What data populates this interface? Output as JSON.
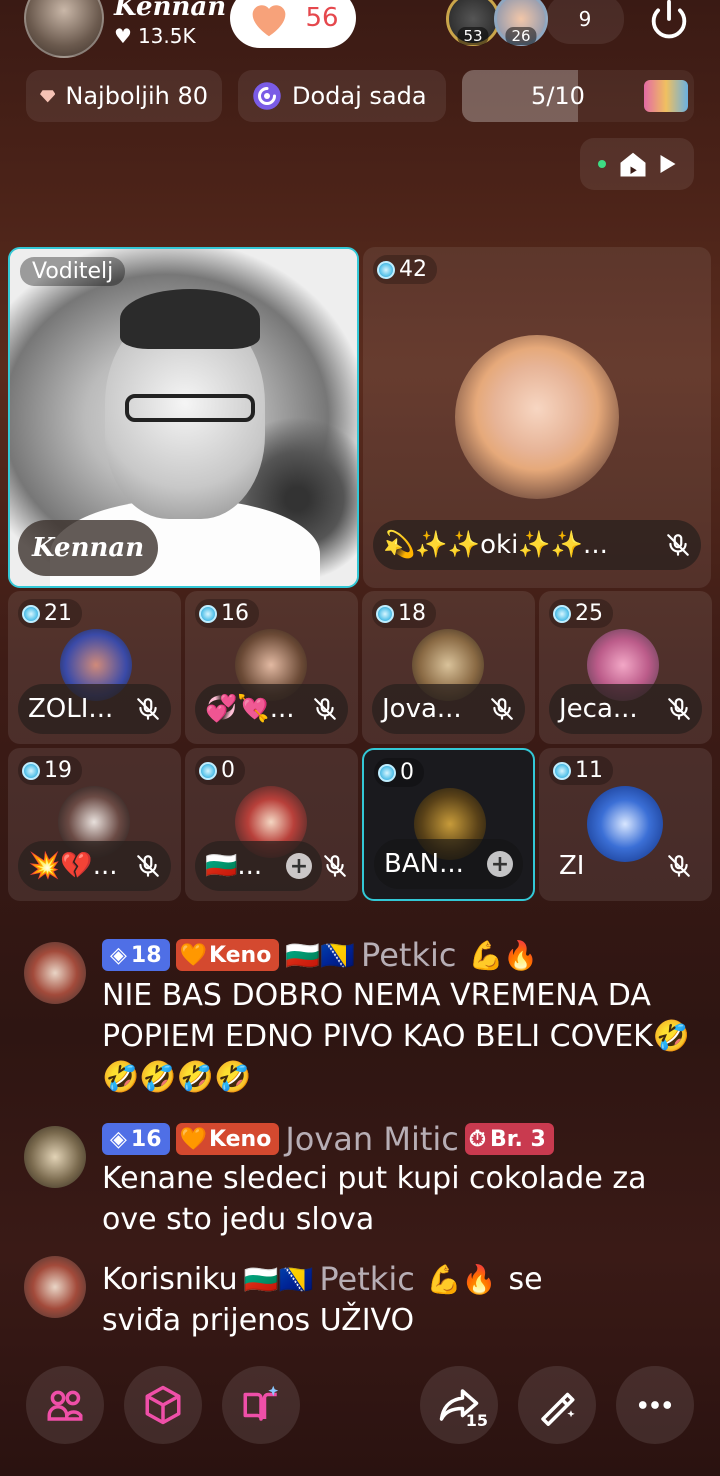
{
  "host": {
    "name": "Kennan",
    "likes": "13.5K",
    "heart_count": "56"
  },
  "viewers": {
    "badges": [
      "53",
      "26"
    ],
    "count": "9"
  },
  "chips": {
    "top_label": "Najboljih 80",
    "add_label": "Dodaj sada",
    "progress_text": "5/10",
    "progress_fraction": 0.5
  },
  "host_tile": {
    "role": "Voditelj",
    "name": "Kennan"
  },
  "guests": [
    {
      "score": "42",
      "name": "💫✨✨oki✨✨..."
    },
    {
      "score": "21",
      "name": "ZOLI..."
    },
    {
      "score": "16",
      "name": "💞💘..."
    },
    {
      "score": "18",
      "name": "Jova..."
    },
    {
      "score": "25",
      "name": "Jeca..."
    },
    {
      "score": "19",
      "name": "💥💔..."
    },
    {
      "score": "0",
      "name": "🇧🇬..."
    },
    {
      "score": "0",
      "name": "BAN..."
    },
    {
      "score": "11",
      "name": "ZI"
    }
  ],
  "chat": [
    {
      "level": "18",
      "fan_club": "Keno",
      "flags": "🇧🇬🇧🇦",
      "user": "Petkic",
      "emoji": "💪🔥",
      "text": "NIE BAS DOBRO NEMA VREMENA DA POPIEM EDNO PIVO KAO BELI COVEK🤣🤣🤣🤣🤣"
    },
    {
      "level": "16",
      "fan_club": "Keno",
      "user": "Jovan Mitic",
      "rank": "Br. 3",
      "text": "Kenane sledeci put kupi cokolade za ove sto jedu slova"
    },
    {
      "prefix": "Korisniku",
      "flags": "🇧🇬🇧🇦",
      "user": "Petkic",
      "emoji": "💪🔥",
      "suffix": "se",
      "text": "sviđa prijenos UŽIVO"
    }
  ],
  "share_count": "15",
  "colors": {
    "accent": "#33c8d6",
    "level_badge": "#4f6fe6",
    "fan_badge": "#d4492f",
    "heart": "#f7a27a"
  }
}
